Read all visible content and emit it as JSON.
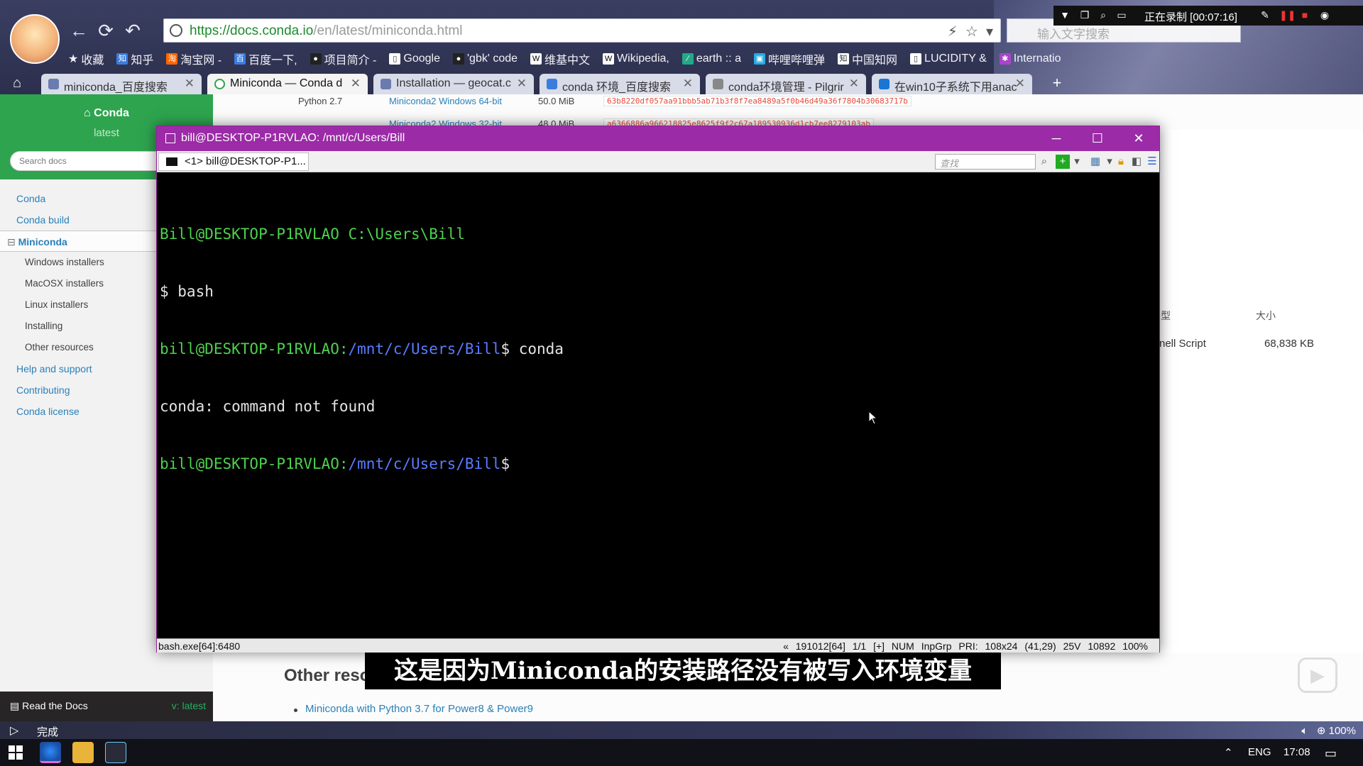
{
  "browser": {
    "url_scheme": "https://",
    "url_host": "docs.conda.io",
    "url_path": "/en/latest/miniconda.html",
    "search_placeholder": "输入文字搜索",
    "recording": "正在录制 [00:07:16]",
    "bookmarks": [
      "收藏",
      "知乎",
      "淘宝网 -",
      "百度一下,",
      "项目简介 -",
      "Google",
      "'gbk' code",
      "维基中文",
      "Wikipedia,",
      "earth :: a",
      "哔哩哔哩弹",
      "中国知网",
      "LUCIDITY &",
      "Internatio"
    ],
    "tabs": [
      {
        "label": "miniconda_百度搜索",
        "active": false
      },
      {
        "label": "Miniconda — Conda d",
        "active": true
      },
      {
        "label": "Installation — geocat.c",
        "active": false
      },
      {
        "label": "conda 环境_百度搜索",
        "active": false
      },
      {
        "label": "conda环境管理 - Pilgrir",
        "active": false
      },
      {
        "label": "在win10子系统下用anac",
        "active": false
      }
    ],
    "status_text": "完成",
    "zoom": "100%"
  },
  "docs": {
    "project": "Conda",
    "version": "latest",
    "search_placeholder": "Search docs",
    "nav": [
      {
        "label": "Conda",
        "level": 1
      },
      {
        "label": "Conda build",
        "level": 1
      },
      {
        "label": "Miniconda",
        "level": 1,
        "current": true
      },
      {
        "label": "Windows installers",
        "level": 2
      },
      {
        "label": "MacOSX installers",
        "level": 2
      },
      {
        "label": "Linux installers",
        "level": 2
      },
      {
        "label": "Installing",
        "level": 2
      },
      {
        "label": "Other resources",
        "level": 2
      },
      {
        "label": "Help and support",
        "level": 1
      },
      {
        "label": "Contributing",
        "level": 1
      },
      {
        "label": "Conda license",
        "level": 1
      }
    ],
    "footer_label": "Read the Docs",
    "footer_version": "v: latest",
    "table_rows": [
      {
        "python": "Python 2.7",
        "name": "Miniconda2 Windows 64-bit",
        "size": "50.0 MiB",
        "hash": "63b8220df057aa91bbb5ab71b3f8f7ea8489a5f0b46d49a36f7804b30683717b"
      },
      {
        "python": "",
        "name": "Miniconda2 Windows 32-bit",
        "size": "48.0 MiB",
        "hash": "a6366886a966218825e8625f9f2c67a189530936d1cb7ee8279103ab"
      }
    ],
    "section_heading": "Other reso",
    "section_link": "Miniconda with Python 3.7 for Power8 & Power9"
  },
  "explorer": {
    "col_type": "型",
    "col_size": "大小",
    "type_value": "nell Script",
    "size_value": "68,838 KB"
  },
  "terminal": {
    "title": "bill@DESKTOP-P1RVLAO: /mnt/c/Users/Bill",
    "tab_label": "<1> bill@DESKTOP-P1...",
    "find_placeholder": "查找",
    "lines": {
      "l1": "Bill@DESKTOP-P1RVLAO C:\\Users\\Bill",
      "l2": "$ bash",
      "l3_user": "bill@DESKTOP-P1RVLAO:",
      "l3_path": "/mnt/c/Users/Bill",
      "l3_cmd": "$ conda",
      "l4": "conda: command not found",
      "l5_user": "bill@DESKTOP-P1RVLAO:",
      "l5_path": "/mnt/c/Users/Bill",
      "l5_cmd": "$"
    },
    "status_left": "bash.exe[64]:6480",
    "status_right": "« 191012[64]   1/1   [+] NUM  InpGrp   PRI:  108x24   (41,29) 25V   10892  100%"
  },
  "subtitle": "这是因为Miniconda的安装路径没有被写入环境变量",
  "taskbar": {
    "lang": "ENG",
    "time": "17:08"
  },
  "colors": {
    "rtd_green": "#2ea44f",
    "terminal_title": "#9b2ba6",
    "prompt_green": "#4ed04e",
    "prompt_path": "#5a7cff"
  }
}
